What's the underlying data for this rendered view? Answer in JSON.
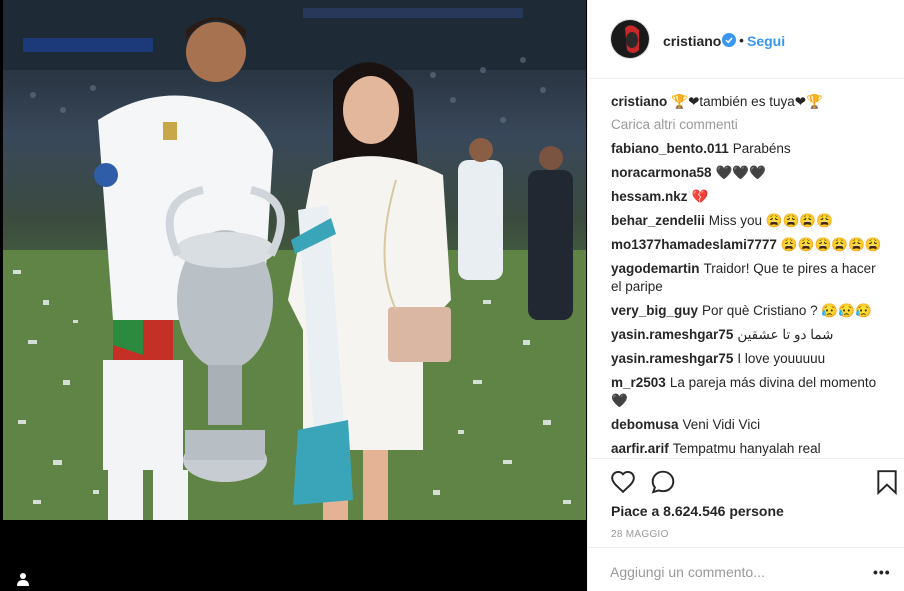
{
  "post": {
    "username": "cristiano",
    "follow_label": "Segui",
    "dot": "•",
    "caption_user": "cristiano",
    "caption_text": "🏆❤también es tuya❤🏆",
    "load_more": "Carica altri commenti",
    "likes": "Piace a 8.624.546 persone",
    "date": "28 MAGGIO",
    "comment_placeholder": "Aggiungi un commento...",
    "more": "•••",
    "accent_color": "#3897f0"
  },
  "comments": [
    {
      "user": "fabiano_bento.011",
      "text": "Parabéns"
    },
    {
      "user": "noracarmona58",
      "text": "🖤🖤🖤"
    },
    {
      "user": "hessam.nkz",
      "text": "💔"
    },
    {
      "user": "behar_zendelii",
      "text": "Miss you 😩😩😩😩"
    },
    {
      "user": "mo1377hamadeslami7777",
      "text": "😩😩😩😩😩😩"
    },
    {
      "user": "yagodemartin",
      "text": "Traidor! Que te pires a hacer el paripe"
    },
    {
      "user": "very_big_guy",
      "text": "Por què Cristiano ? 😥😥😥"
    },
    {
      "user": "yasin.rameshgar75",
      "text": "شما دو تا عشقین"
    },
    {
      "user": "yasin.rameshgar75",
      "text": "I love youuuuu"
    },
    {
      "user": "m_r2503",
      "text": "La pareja más divina del momento 🖤"
    },
    {
      "user": "debomusa",
      "text": "Veni Vidi Vici"
    },
    {
      "user": "aarfir.arif",
      "text": "Tempatmu hanyalah real"
    }
  ],
  "icons": {
    "like": "heart-icon",
    "comment": "comment-bubble-icon",
    "save": "bookmark-icon",
    "tag": "user-tag-icon",
    "verified": "verified-badge-icon"
  }
}
